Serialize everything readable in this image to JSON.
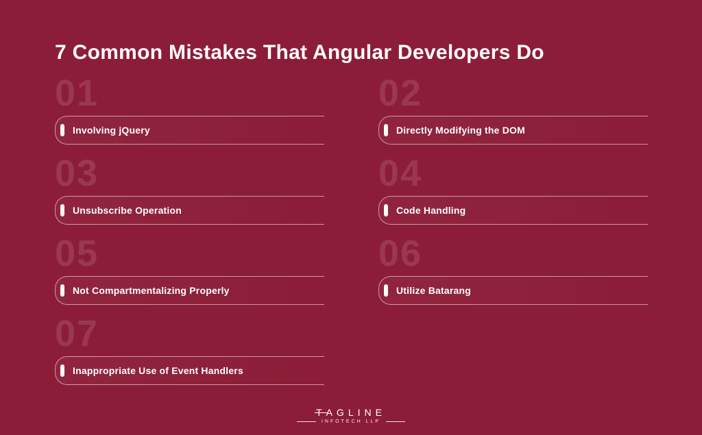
{
  "title": "7 Common Mistakes That Angular Developers Do",
  "items": [
    {
      "num": "01",
      "label": "Involving jQuery"
    },
    {
      "num": "02",
      "label": "Directly Modifying the DOM"
    },
    {
      "num": "03",
      "label": "Unsubscribe Operation"
    },
    {
      "num": "04",
      "label": "Code Handling"
    },
    {
      "num": "05",
      "label": "Not Compartmentalizing Properly"
    },
    {
      "num": "06",
      "label": "Utilize Batarang"
    },
    {
      "num": "07",
      "label": "Inappropriate Use of Event Handlers"
    }
  ],
  "footer": {
    "brand_prefix": "T",
    "brand_rest": "AGLINE",
    "subtitle": "INFOTECH LLP"
  }
}
